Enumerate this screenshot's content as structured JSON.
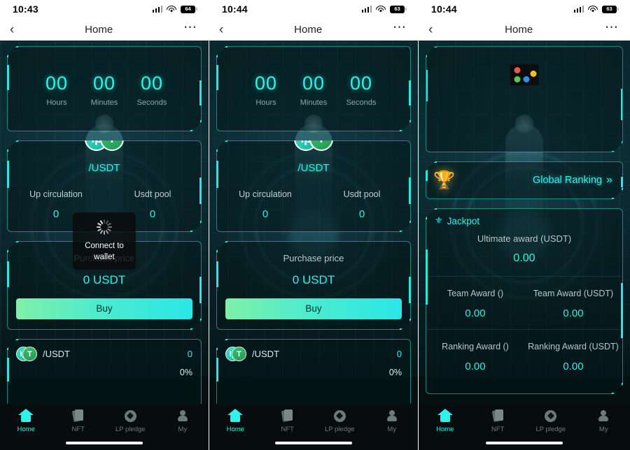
{
  "screens": [
    {
      "id": "screen-loading",
      "status_bar": {
        "time": "10:43",
        "battery": "64",
        "signal_icon": "signal-bars-icon",
        "wifi_icon": "wifi-icon",
        "battery_icon": "battery-icon"
      },
      "nav": {
        "back_icon": "chevron-left-icon",
        "title": "Home",
        "more_icon": "more-dots-icon"
      },
      "countdown": {
        "units": [
          {
            "value": "00",
            "label": "Hours"
          },
          {
            "value": "00",
            "label": "Minutes"
          },
          {
            "value": "00",
            "label": "Seconds"
          }
        ]
      },
      "pair": {
        "coin_a_icon": "coin-ip-icon",
        "coin_b_icon": "coin-tether-icon",
        "name": "/USDT",
        "stats": [
          {
            "label": "Up circulation",
            "value": "0"
          },
          {
            "label": "Usdt pool",
            "value": "0"
          }
        ]
      },
      "purchase": {
        "label": "Purchase price",
        "value": "0 USDT",
        "buy_label": "Buy"
      },
      "list": [
        {
          "name": "/USDT",
          "value": "0",
          "percent": "0%",
          "coin_a_icon": "coin-ip-icon",
          "coin_b_icon": "coin-tether-icon"
        }
      ],
      "toast": {
        "visible": true,
        "text": "Connect to wallet",
        "spinner_icon": "loading-spinner-icon"
      },
      "tabbar": [
        {
          "label": "Home",
          "icon": "home-icon",
          "active": true
        },
        {
          "label": "NFT",
          "icon": "cards-icon",
          "active": false
        },
        {
          "label": "LP pledge",
          "icon": "diamond-circle-icon",
          "active": false
        },
        {
          "label": "My",
          "icon": "person-icon",
          "active": false
        }
      ]
    },
    {
      "id": "screen-loaded",
      "status_bar": {
        "time": "10:44",
        "battery": "63",
        "signal_icon": "signal-bars-icon",
        "wifi_icon": "wifi-icon",
        "battery_icon": "battery-icon"
      },
      "nav": {
        "back_icon": "chevron-left-icon",
        "title": "Home",
        "more_icon": "more-dots-icon"
      },
      "countdown": {
        "units": [
          {
            "value": "00",
            "label": "Hours"
          },
          {
            "value": "00",
            "label": "Minutes"
          },
          {
            "value": "00",
            "label": "Seconds"
          }
        ]
      },
      "pair": {
        "coin_a_icon": "coin-ip-icon",
        "coin_b_icon": "coin-tether-icon",
        "name": "/USDT",
        "stats": [
          {
            "label": "Up circulation",
            "value": "0"
          },
          {
            "label": "Usdt pool",
            "value": "0"
          }
        ]
      },
      "purchase": {
        "label": "Purchase price",
        "value": "0 USDT",
        "buy_label": "Buy"
      },
      "list": [
        {
          "name": "/USDT",
          "value": "0",
          "percent": "0%",
          "coin_a_icon": "coin-ip-icon",
          "coin_b_icon": "coin-tether-icon"
        }
      ],
      "toast": {
        "visible": false,
        "text": "",
        "spinner_icon": ""
      },
      "tabbar": [
        {
          "label": "Home",
          "icon": "home-icon",
          "active": true
        },
        {
          "label": "NFT",
          "icon": "cards-icon",
          "active": false
        },
        {
          "label": "LP pledge",
          "icon": "diamond-circle-icon",
          "active": false
        },
        {
          "label": "My",
          "icon": "person-icon",
          "active": false
        }
      ]
    },
    {
      "id": "screen-jackpot",
      "status_bar": {
        "time": "10:44",
        "battery": "63",
        "signal_icon": "signal-bars-icon",
        "wifi_icon": "wifi-icon",
        "battery_icon": "battery-icon"
      },
      "nav": {
        "back_icon": "chevron-left-icon",
        "title": "Home",
        "more_icon": "more-dots-icon"
      },
      "banner": {
        "badge_icon": "four-color-dots-icon",
        "dot_colors": [
          "#e8564e",
          "#f0c219",
          "#5ec44a",
          "#2f8fe8"
        ]
      },
      "ranking": {
        "trophy_icon": "trophy-icon",
        "label": "Global Ranking",
        "chevron_icon": "chevron-right-icon"
      },
      "jackpot": {
        "icon": "jackpot-medal-icon",
        "title": "Jackpot",
        "hero": {
          "label": "Ultimate award (USDT)",
          "value": "0.00"
        },
        "rows": [
          [
            {
              "label": "Team Award ()",
              "value": "0.00"
            },
            {
              "label": "Team Award (USDT)",
              "value": "0.00"
            }
          ],
          [
            {
              "label": "Ranking Award ()",
              "value": "0.00"
            },
            {
              "label": "Ranking Award (USDT)",
              "value": "0.00"
            }
          ]
        ]
      },
      "tabbar": [
        {
          "label": "Home",
          "icon": "home-icon",
          "active": true
        },
        {
          "label": "NFT",
          "icon": "cards-icon",
          "active": false
        },
        {
          "label": "LP pledge",
          "icon": "diamond-circle-icon",
          "active": false
        },
        {
          "label": "My",
          "icon": "person-icon",
          "active": false
        }
      ]
    }
  ],
  "theme": {
    "accent": "#2ff3ea",
    "buy_gradient_start": "#7ff0a8",
    "buy_gradient_end": "#2ae6e6",
    "bg_dark": "#05110f"
  }
}
